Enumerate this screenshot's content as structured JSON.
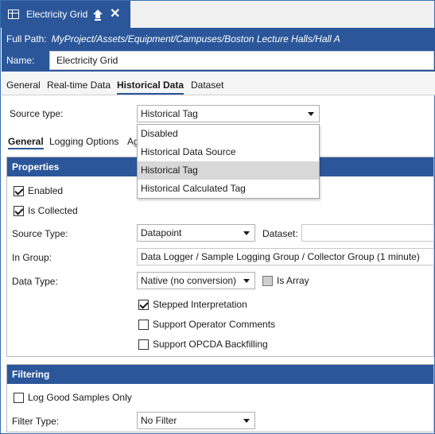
{
  "tab": {
    "title": "Electricity Grid",
    "icon": "grid-icon",
    "pin_icon": "pin-icon",
    "close_glyph": "✕"
  },
  "header": {
    "path_label": "Full Path:",
    "path_value": "MyProject/Assets/Equipment/Campuses/Boston Lecture Halls/Hall A",
    "name_label": "Name:",
    "name_value": "Electricity Grid"
  },
  "main_tabs": [
    {
      "label": "General",
      "active": false
    },
    {
      "label": "Real-time Data",
      "active": false
    },
    {
      "label": "Historical Data",
      "active": true
    },
    {
      "label": "Dataset",
      "active": false
    }
  ],
  "source": {
    "label": "Source type:",
    "selected": "Historical Tag",
    "options": [
      "Disabled",
      "Historical Data Source",
      "Historical Tag",
      "Historical Calculated Tag"
    ]
  },
  "sub_tabs": [
    {
      "label": "General",
      "active": true
    },
    {
      "label": "Logging Options",
      "active": false
    },
    {
      "label": "Ag",
      "active": false
    }
  ],
  "properties": {
    "title": "Properties",
    "enabled_label": "Enabled",
    "enabled": true,
    "collected_label": "Is Collected",
    "collected": true,
    "source_type_label": "Source Type:",
    "source_type_value": "Datapoint",
    "dataset_label": "Dataset:",
    "dataset_value": "",
    "group_label": "In Group:",
    "group_value": "Data Logger / Sample Logging Group / Collector Group (1 minute)",
    "data_type_label": "Data Type:",
    "data_type_value": "Native (no conversion)",
    "is_array_label": "Is Array",
    "is_array": false,
    "stepped_label": "Stepped Interpretation",
    "stepped": true,
    "operator_comments_label": "Support Operator Comments",
    "operator_comments": false,
    "backfilling_label": "Support OPCDA Backfilling",
    "backfilling": false
  },
  "filtering": {
    "title": "Filtering",
    "log_good_label": "Log Good Samples Only",
    "log_good": false,
    "filter_type_label": "Filter Type:",
    "filter_type_value": "No Filter"
  },
  "colors": {
    "accent": "#2b579a",
    "selection": "#d8d8d8"
  }
}
